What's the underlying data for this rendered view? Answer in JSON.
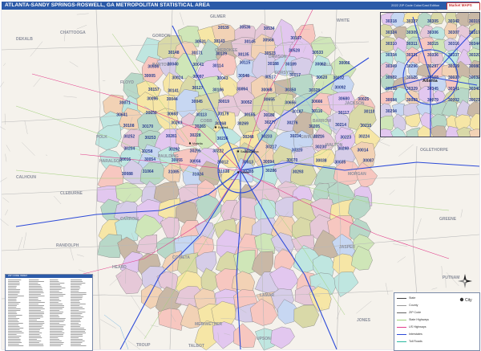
{
  "header": {
    "title": "ATLANTA-SANDY SPRINGS-ROSWELL, GA METROPOLITAN STATISTICAL AREA",
    "edition": "2022 ZIP Code Color/Cast Edition",
    "logo_text": "Market MAPS"
  },
  "colors": {
    "title_bar": "#2b5aa8",
    "county_line": "#c2c2c2",
    "interstate": "#2d4bd8",
    "us_highway": "#e23d8a",
    "state_highway": "#9fd07a",
    "zip_boundary": "#707070",
    "zip_label": "#2a3f8f",
    "county_label": "#8b8f9c"
  },
  "counties": [
    "GILMER",
    "DEKALB",
    "CHATTOOGA",
    "GORDON",
    "BARTOW",
    "DAWSON",
    "WHITE",
    "CHEROKEE",
    "FORSYTH",
    "FLOYD",
    "HALL",
    "JACKSON",
    "BARROW",
    "POLK",
    "HARALSON",
    "PAULDING",
    "CALHOUN",
    "CLEBURNE",
    "OGLETHORPE",
    "CARROLL",
    "GREENE",
    "RANDOLPH",
    "CLAY",
    "HEARD",
    "COWETA",
    "JASPER",
    "PUTNAM",
    "HANCOCK",
    "MERIWETHER",
    "LAMAR",
    "JONES",
    "TROUP",
    "TALBOT",
    "UPSON",
    "HARRIS",
    "WALTON",
    "MORGAN",
    "COBB",
    "GWINNETT"
  ],
  "cities": [
    "Atlanta",
    "Marietta",
    "Roswell",
    "Sandy Springs"
  ],
  "zip_labels": [
    "30539",
    "30536",
    "30534",
    "30531",
    "30143",
    "30145",
    "30566",
    "30107",
    "30148",
    "30171",
    "30139",
    "30135",
    "30523",
    "30528",
    "30533",
    "30506",
    "30040",
    "30041",
    "30114",
    "30115",
    "30188",
    "30189",
    "30062",
    "30066",
    "30005",
    "30024",
    "30097",
    "30043",
    "30548",
    "30517",
    "30017",
    "30620",
    "30132",
    "30157",
    "30141",
    "30127",
    "30106",
    "30064",
    "30068",
    "30350",
    "30328",
    "30092",
    "30071",
    "30096",
    "30044",
    "30045",
    "30019",
    "30052",
    "30655",
    "30656",
    "30666",
    "30680",
    "30025",
    "30641",
    "30650",
    "30663",
    "30113",
    "30179",
    "30185",
    "30180",
    "30187",
    "30116",
    "30117",
    "30110",
    "30108",
    "30170",
    "30263",
    "30265",
    "30268",
    "30269",
    "30277",
    "30276",
    "30205",
    "30214",
    "30215",
    "30252",
    "30253",
    "30281",
    "30228",
    "30236",
    "30248",
    "30233",
    "30234",
    "30216",
    "30223",
    "30224",
    "30204",
    "30258",
    "30292",
    "30295",
    "30222",
    "30218",
    "30217",
    "30220",
    "30230",
    "30240",
    "30014",
    "30016",
    "30054",
    "30055",
    "30056",
    "30012",
    "30013",
    "30094",
    "30070",
    "30038",
    "30035",
    "30087",
    "30088",
    "31064",
    "31085",
    "31024",
    "31038",
    "30285",
    "30286",
    "30293"
  ],
  "legend": {
    "rows": [
      {
        "label": "State",
        "symbol": "line"
      },
      {
        "label": "County",
        "symbol": "line"
      },
      {
        "label": "ZIP Code",
        "symbol": "line"
      },
      {
        "label": "State Highways",
        "symbol": "line"
      },
      {
        "label": "US Highways",
        "symbol": "line"
      },
      {
        "label": "Interstates",
        "symbol": "line"
      },
      {
        "label": "Toll Roads",
        "symbol": "line"
      }
    ],
    "city_label": "City"
  },
  "inset": {
    "city_label": "Atlanta",
    "zip_labels": [
      "30318",
      "30327",
      "30305",
      "30342",
      "30319",
      "30324",
      "30309",
      "30306",
      "30307",
      "30317",
      "30310",
      "30311",
      "30315",
      "30316",
      "30344",
      "30354",
      "30331",
      "30336",
      "30337",
      "30320",
      "30349",
      "30296",
      "30297",
      "30339",
      "30080",
      "30082",
      "30126",
      "30168",
      "30030",
      "30032",
      "30033",
      "30329",
      "30345",
      "30341",
      "30340",
      "30084",
      "30083",
      "30079",
      "30002",
      "30021",
      "30294"
    ]
  },
  "index_panel": {
    "title": "ZIP CODE INDEX"
  }
}
